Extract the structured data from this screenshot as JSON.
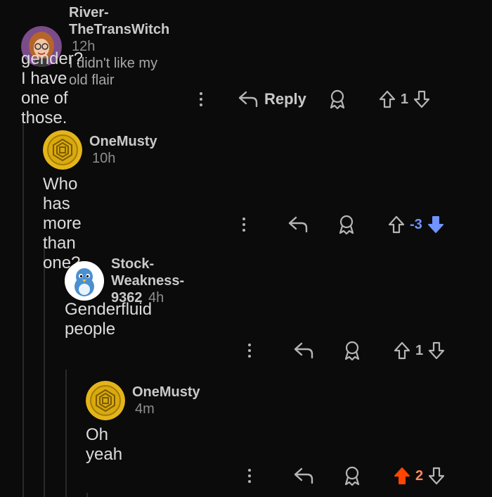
{
  "comments": [
    {
      "username": "River-TheTransWitch",
      "time": "12h",
      "flair": "I didn't like my old flair",
      "body": "gender? I have one of those.",
      "reply_label": "Reply",
      "score": "1",
      "vote": "none",
      "avatar_icon": "person-avatar-icon"
    },
    {
      "username": "OneMusty",
      "time": "10h",
      "body": "Who has more than one?",
      "score": "-3",
      "vote": "down",
      "avatar_icon": "gold-coin-avatar-icon"
    },
    {
      "username": "Stock-Weakness-9362",
      "time": "4h",
      "body": "Genderfluid people",
      "score": "1",
      "vote": "none",
      "avatar_icon": "bird-avatar-icon"
    },
    {
      "username": "OneMusty",
      "time": "4m",
      "body": "Oh yeah",
      "score": "2",
      "vote": "up",
      "avatar_icon": "gold-coin-avatar-icon"
    }
  ],
  "colors": {
    "background": "#0b0b0b",
    "upvote": "#ff4500",
    "downvote": "#7193ff",
    "neutral": "#b5b5b5"
  }
}
